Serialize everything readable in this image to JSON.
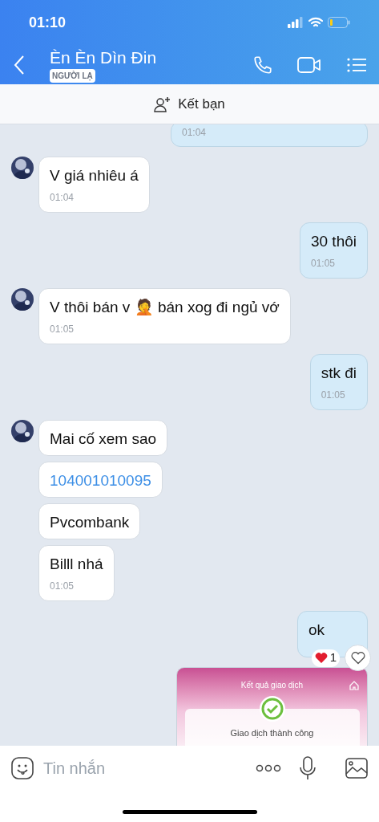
{
  "status_bar": {
    "time": "01:10"
  },
  "header": {
    "name": "Èn Èn Dìn Đin",
    "badge": "NGƯỜI LẠ"
  },
  "friend_bar": {
    "label": "Kết bạn"
  },
  "messages": [
    {
      "kind": "text",
      "outgoing": true,
      "time": "01:04"
    },
    {
      "kind": "text",
      "outgoing": false,
      "text": "V giá nhiêu á",
      "time": "01:04",
      "avatar": true
    },
    {
      "kind": "text",
      "outgoing": true,
      "text": "30 thôi",
      "time": "01:05"
    },
    {
      "kind": "text",
      "outgoing": false,
      "text": "V thôi bán v 🤦 bán xog đi ngủ vớ",
      "time": "01:05",
      "avatar": true
    },
    {
      "kind": "text",
      "outgoing": true,
      "text": "stk đi",
      "time": "01:05"
    },
    {
      "kind": "text",
      "outgoing": false,
      "text": "Mai cố xem sao",
      "avatar": true
    },
    {
      "kind": "link",
      "outgoing": false,
      "text": "104001010095",
      "avatar": false
    },
    {
      "kind": "text",
      "outgoing": false,
      "text": "Pvcombank",
      "avatar": false
    },
    {
      "kind": "text",
      "outgoing": false,
      "text": "Billl nhá",
      "time": "01:05",
      "avatar": false
    },
    {
      "kind": "text",
      "outgoing": true,
      "text": "ok",
      "reaction": {
        "count": "1"
      }
    },
    {
      "kind": "receipt",
      "outgoing": true,
      "title": "Kết quả giao dịch",
      "status": "Giao dịch thành công"
    }
  ],
  "composer": {
    "placeholder": "Tin nhắn"
  }
}
